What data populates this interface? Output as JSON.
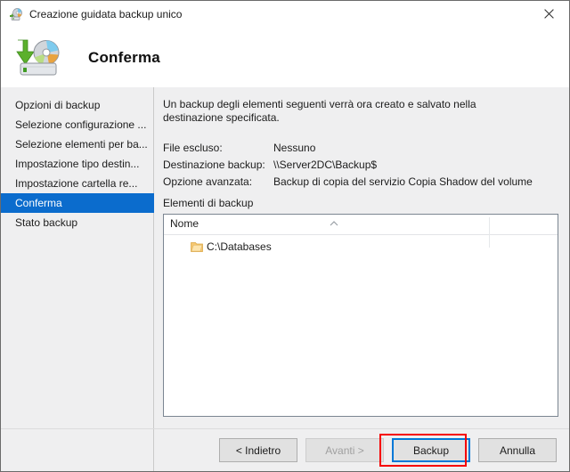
{
  "window": {
    "title": "Creazione guidata backup unico",
    "icon": "backup-wizard-icon",
    "close_icon": "close-icon"
  },
  "header": {
    "title": "Conferma",
    "icon": "backup-disk-icon"
  },
  "sidebar": {
    "items": [
      {
        "label": "Opzioni di backup",
        "selected": false
      },
      {
        "label": "Selezione configurazione ...",
        "selected": false
      },
      {
        "label": "Selezione elementi per ba...",
        "selected": false
      },
      {
        "label": "Impostazione tipo destin...",
        "selected": false
      },
      {
        "label": "Impostazione cartella re...",
        "selected": false
      },
      {
        "label": "Conferma",
        "selected": true
      },
      {
        "label": "Stato backup",
        "selected": false
      }
    ],
    "selected_color": "#0b6ccd"
  },
  "content": {
    "intro": "Un backup degli elementi seguenti verrà ora creato e salvato nella destinazione specificata.",
    "summary": [
      {
        "label": "File escluso:",
        "value": "Nessuno"
      },
      {
        "label": "Destinazione backup:",
        "value": "\\\\Server2DC\\Backup$"
      },
      {
        "label": "Opzione avanzata:",
        "value": "Backup di copia del servizio Copia Shadow del volume"
      }
    ],
    "items_caption": "Elementi di backup",
    "list": {
      "column_header": "Nome",
      "sort_indicator": "sort-ascending-icon",
      "rows": [
        {
          "label": "C:\\Databases",
          "icon": "folder-icon"
        }
      ]
    }
  },
  "buttons": {
    "back": {
      "label": "< Indietro",
      "disabled": false,
      "default": false
    },
    "next": {
      "label": "Avanti >",
      "disabled": true,
      "default": false
    },
    "backup": {
      "label": "Backup",
      "disabled": false,
      "default": true
    },
    "cancel": {
      "label": "Annulla",
      "disabled": false,
      "default": false
    }
  },
  "annotation": {
    "highlight_color": "#f60000",
    "target": "backup-button"
  }
}
